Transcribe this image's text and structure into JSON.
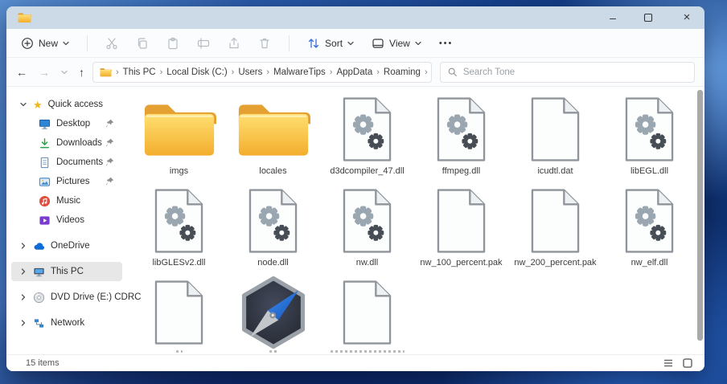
{
  "window": {
    "minimize_glyph": "–",
    "close_glyph": "×"
  },
  "toolbar": {
    "new_label": "New",
    "sort_label": "Sort",
    "view_label": "View",
    "more_glyph": "•••"
  },
  "navbar": {
    "separator": "›",
    "breadcrumbs": [
      "This PC",
      "Local Disk (C:)",
      "Users",
      "MalwareTips",
      "AppData",
      "Roaming"
    ],
    "search_placeholder": "Search Tone"
  },
  "sidebar": {
    "quick_access_label": "Quick access",
    "quick_items": [
      {
        "label": "Desktop",
        "pinned": true
      },
      {
        "label": "Downloads",
        "pinned": true
      },
      {
        "label": "Documents",
        "pinned": true
      },
      {
        "label": "Pictures",
        "pinned": true
      },
      {
        "label": "Music",
        "pinned": false
      },
      {
        "label": "Videos",
        "pinned": false
      }
    ],
    "tree_items": [
      {
        "label": "OneDrive",
        "selected": false
      },
      {
        "label": "This PC",
        "selected": true
      },
      {
        "label": "DVD Drive (E:) CDRC",
        "selected": false
      },
      {
        "label": "Network",
        "selected": false
      }
    ]
  },
  "files": {
    "items": [
      {
        "label": "imgs",
        "type": "folder"
      },
      {
        "label": "locales",
        "type": "folder"
      },
      {
        "label": "d3dcompiler_47.dll",
        "type": "dll"
      },
      {
        "label": "ffmpeg.dll",
        "type": "dll"
      },
      {
        "label": "icudtl.dat",
        "type": "file"
      },
      {
        "label": "libEGL.dll",
        "type": "dll"
      },
      {
        "label": "libGLESv2.dll",
        "type": "dll"
      },
      {
        "label": "node.dll",
        "type": "dll"
      },
      {
        "label": "nw.dll",
        "type": "dll"
      },
      {
        "label": "nw_100_percent.pak",
        "type": "file"
      },
      {
        "label": "nw_200_percent.pak",
        "type": "file"
      },
      {
        "label": "nw_elf.dll",
        "type": "dll"
      },
      {
        "label": "",
        "type": "file"
      },
      {
        "label": "",
        "type": "nwjs-app"
      },
      {
        "label": "",
        "type": "file"
      }
    ]
  },
  "statusbar": {
    "items_count": "15 items"
  },
  "icons": {
    "quick_access_star": "★"
  },
  "colors": {
    "folder_yellow": "#f6b73c",
    "titlebar_blue": "#ccd9e6",
    "wallpaper_blue": "#16418c",
    "selection_gray": "#e7e7e7",
    "gear_light": "#9aa6b0",
    "gear_dark": "#474d54"
  }
}
